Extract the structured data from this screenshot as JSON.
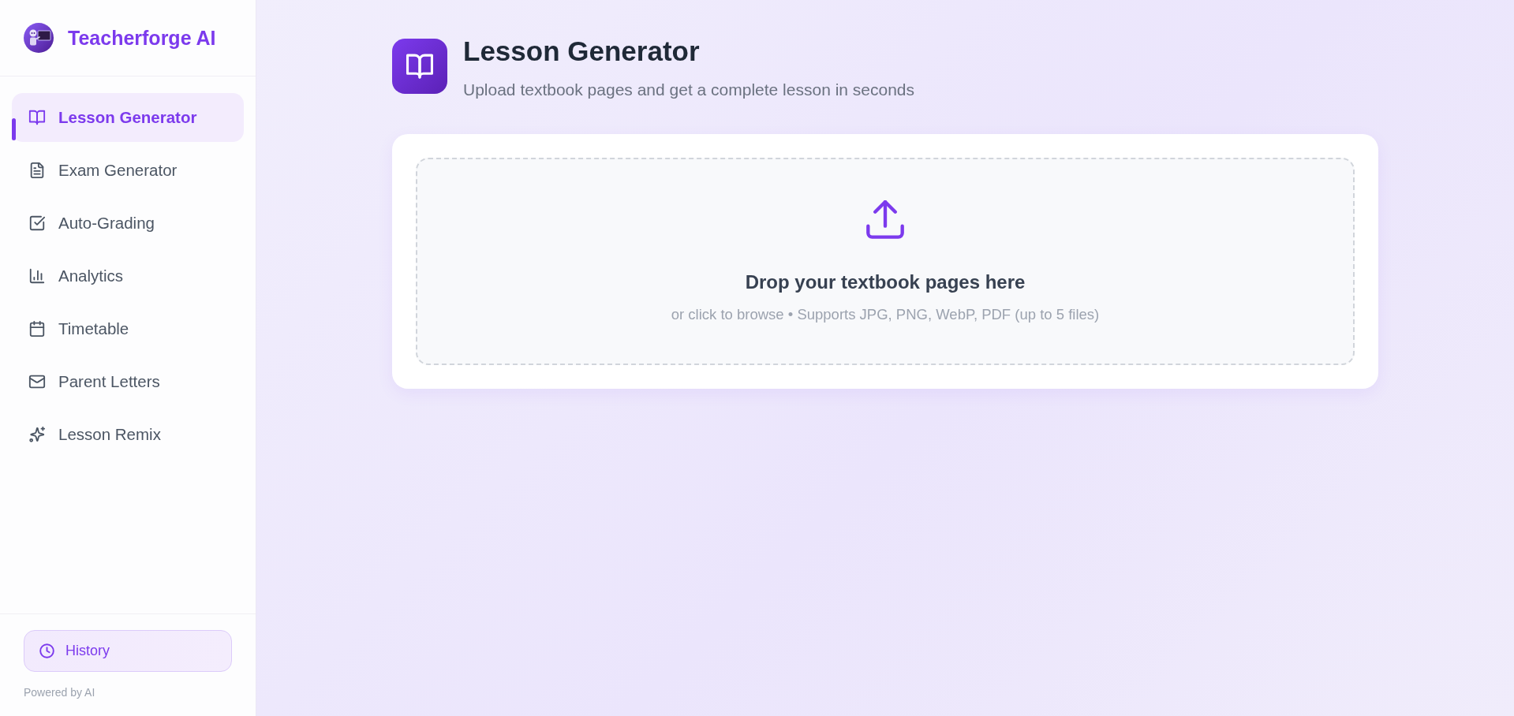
{
  "sidebar": {
    "brand": "Teacherforge AI",
    "nav_items": [
      {
        "label": "Lesson Generator",
        "selected": true
      },
      {
        "label": "Exam Generator",
        "selected": false
      },
      {
        "label": "Auto-Grading",
        "selected": false
      },
      {
        "label": "Analytics",
        "selected": false
      },
      {
        "label": "Timetable",
        "selected": false
      },
      {
        "label": "Parent Letters",
        "selected": false
      },
      {
        "label": "Lesson Remix",
        "selected": false
      }
    ],
    "history_button": "History",
    "footer": "Powered by AI"
  },
  "header": {
    "title": "Lesson Generator",
    "subtitle": "Upload textbook pages and get a complete lesson in seconds"
  },
  "upload": {
    "title": "Drop your textbook pages here",
    "hint": "or click to browse • Supports JPG, PNG, WebP, PDF (up to 5 files)"
  }
}
